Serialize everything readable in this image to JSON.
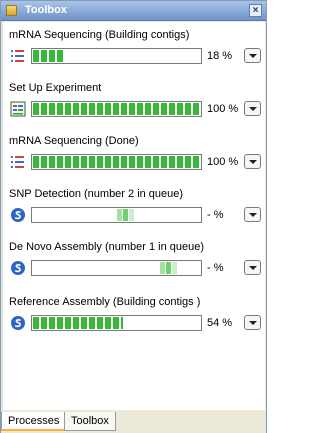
{
  "window": {
    "title": "Toolbox"
  },
  "processes": [
    {
      "title": "mRNA Sequencing (Building contigs)",
      "icon": "mrna-sequencing-icon",
      "progress": 0.18,
      "percent_label": "18 %",
      "state": "running"
    },
    {
      "title": "Set Up Experiment",
      "icon": "setup-experiment-icon",
      "progress": 1.0,
      "percent_label": "100 %",
      "state": "done"
    },
    {
      "title": "mRNA Sequencing (Done)",
      "icon": "mrna-sequencing-icon",
      "progress": 1.0,
      "percent_label": "100 %",
      "state": "done"
    },
    {
      "title": "SNP Detection (number 2 in queue)",
      "icon": "queued-process-icon",
      "progress": null,
      "percent_label": "- %",
      "state": "queued"
    },
    {
      "title": "De Novo Assembly (number 1 in queue)",
      "icon": "queued-process-icon",
      "progress": null,
      "percent_label": "- %",
      "state": "queued"
    },
    {
      "title": "Reference Assembly (Building contigs )",
      "icon": "queued-process-icon",
      "progress": 0.54,
      "percent_label": "54 %",
      "state": "running"
    }
  ],
  "tabs": [
    {
      "label": "Processes",
      "active": true
    },
    {
      "label": "Toolbox",
      "active": false
    }
  ]
}
